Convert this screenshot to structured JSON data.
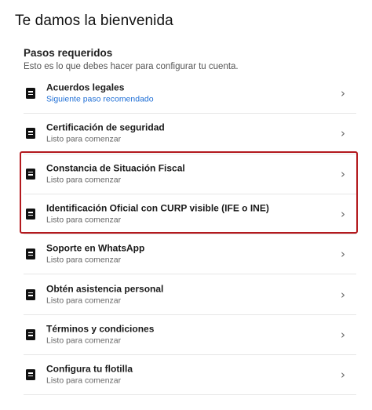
{
  "page": {
    "title": "Te damos la bienvenida"
  },
  "section": {
    "title": "Pasos requeridos",
    "description": "Esto es lo que debes hacer para configurar tu cuenta."
  },
  "items": [
    {
      "label": "Acuerdos legales",
      "sub": "Siguiente paso recomendado",
      "sub_color": "#1f6fd6"
    },
    {
      "label": "Certificación de seguridad",
      "sub": "Listo para comenzar"
    },
    {
      "label": "Constancia de Situación Fiscal",
      "sub": "Listo para comenzar"
    },
    {
      "label": "Identificación Oficial con CURP visible (IFE o INE)",
      "sub": "Listo para comenzar"
    },
    {
      "label": "Soporte en WhatsApp",
      "sub": "Listo para comenzar"
    },
    {
      "label": "Obtén asistencia personal",
      "sub": "Listo para comenzar"
    },
    {
      "label": "Términos y condiciones",
      "sub": "Listo para comenzar"
    },
    {
      "label": "Configura tu flotilla",
      "sub": "Listo para comenzar"
    }
  ],
  "icons": {
    "item_icon": "document-icon",
    "chevron": "›"
  },
  "colors": {
    "highlight": "#b3191e",
    "link": "#1f6fd6"
  }
}
